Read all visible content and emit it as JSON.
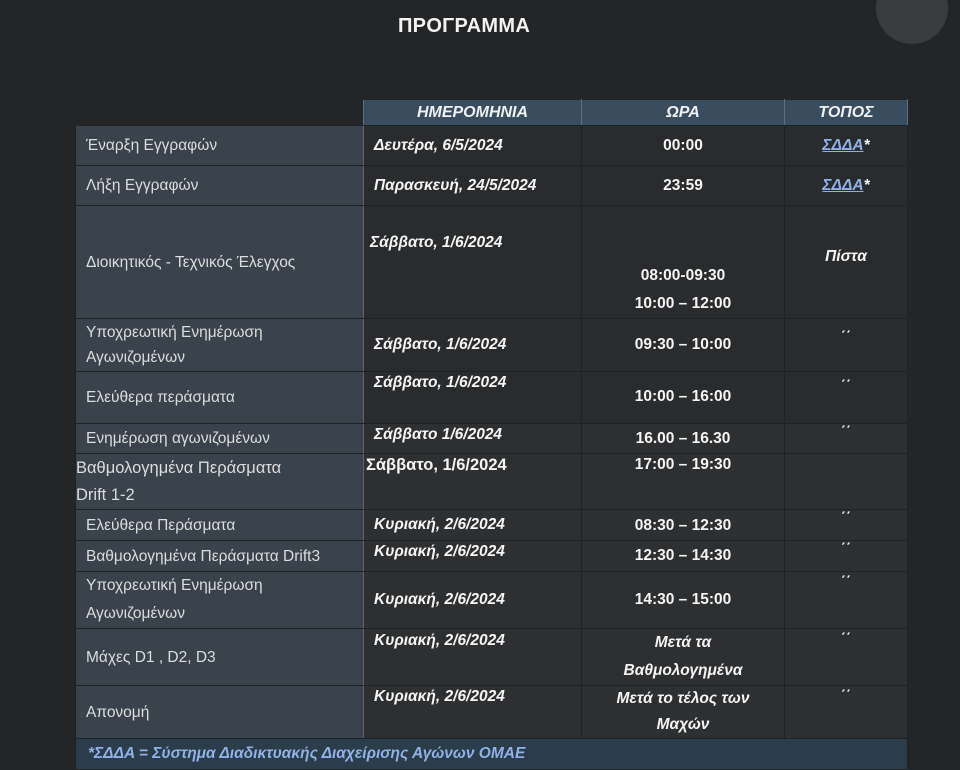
{
  "title": "ΠΡΟΓΡΑΜΜΑ",
  "headers": {
    "date": "ΗΜΕΡΟΜΗΝΙΑ",
    "time": "ΩΡΑ",
    "place": "ΤΟΠΟΣ"
  },
  "rows": [
    {
      "event": "Έναρξη Εγγραφών",
      "date": "Δευτέρα, 6/5/2024",
      "time": "00:00",
      "place_link": "ΣΔΔΑ",
      "place_suffix": "*"
    },
    {
      "event": "Λήξη Εγγραφών",
      "date": "Παρασκευή, 24/5/2024",
      "time": "23:59",
      "place_link": "ΣΔΔΑ",
      "place_suffix": "*"
    },
    {
      "event": "Διοικητικός - Τεχνικός Έλεγχος",
      "date": "Σάββατο, 1/6/2024",
      "time1": "08:00-09:30",
      "time2": "10:00 – 12:00",
      "place": "Πίστα"
    },
    {
      "event1": "Υποχρεωτική Ενημέρωση",
      "event2": "Αγωνιζομένων",
      "date": "Σάββατο, 1/6/2024",
      "time": "09:30 – 10:00",
      "place": "΄΄"
    },
    {
      "event": "Ελεύθερα περάσματα",
      "date": "Σάββατο, 1/6/2024",
      "time": "10:00 – 16:00",
      "place": "΄΄"
    },
    {
      "event": "Ενημέρωση αγωνιζομένων",
      "date": "Σάββατο 1/6/2024",
      "time": "16.00 – 16.30",
      "place": "΄΄"
    },
    {
      "event1": "Βαθμολογημένα Περάσματα",
      "event2": "Drift 1-2",
      "date": "Σάββατο, 1/6/2024",
      "time": "17:00 – 19:30"
    },
    {
      "event": "Ελεύθερα Περάσματα",
      "date": "Κυριακή, 2/6/2024",
      "time": "08:30 – 12:30",
      "place": "΄΄"
    },
    {
      "event": "Βαθμολογημένα Περάσματα Drift3",
      "date": "Κυριακή, 2/6/2024",
      "time": "12:30 – 14:30",
      "place": "΄΄"
    },
    {
      "event1": "Υποχρεωτική Ενημέρωση",
      "event2": "Αγωνιζομένων",
      "date": "Κυριακή, 2/6/2024",
      "time": "14:30 – 15:00",
      "place": "΄΄"
    },
    {
      "event": "Μάχες D1 , D2, D3",
      "date": "Κυριακή, 2/6/2024",
      "time1": "Μετά τα",
      "time2": "Βαθμολογημένα",
      "place": "΄΄"
    },
    {
      "event": "Απονομή",
      "date": "Κυριακή, 2/6/2024",
      "time1": "Μετά το τέλος των",
      "time2": "Μαχών",
      "place": "΄΄"
    }
  ],
  "footer": "*ΣΔΔΑ = Σύστημα Διαδικτυακής Διαχείρισης Αγώνων ΟΜΑΕ"
}
